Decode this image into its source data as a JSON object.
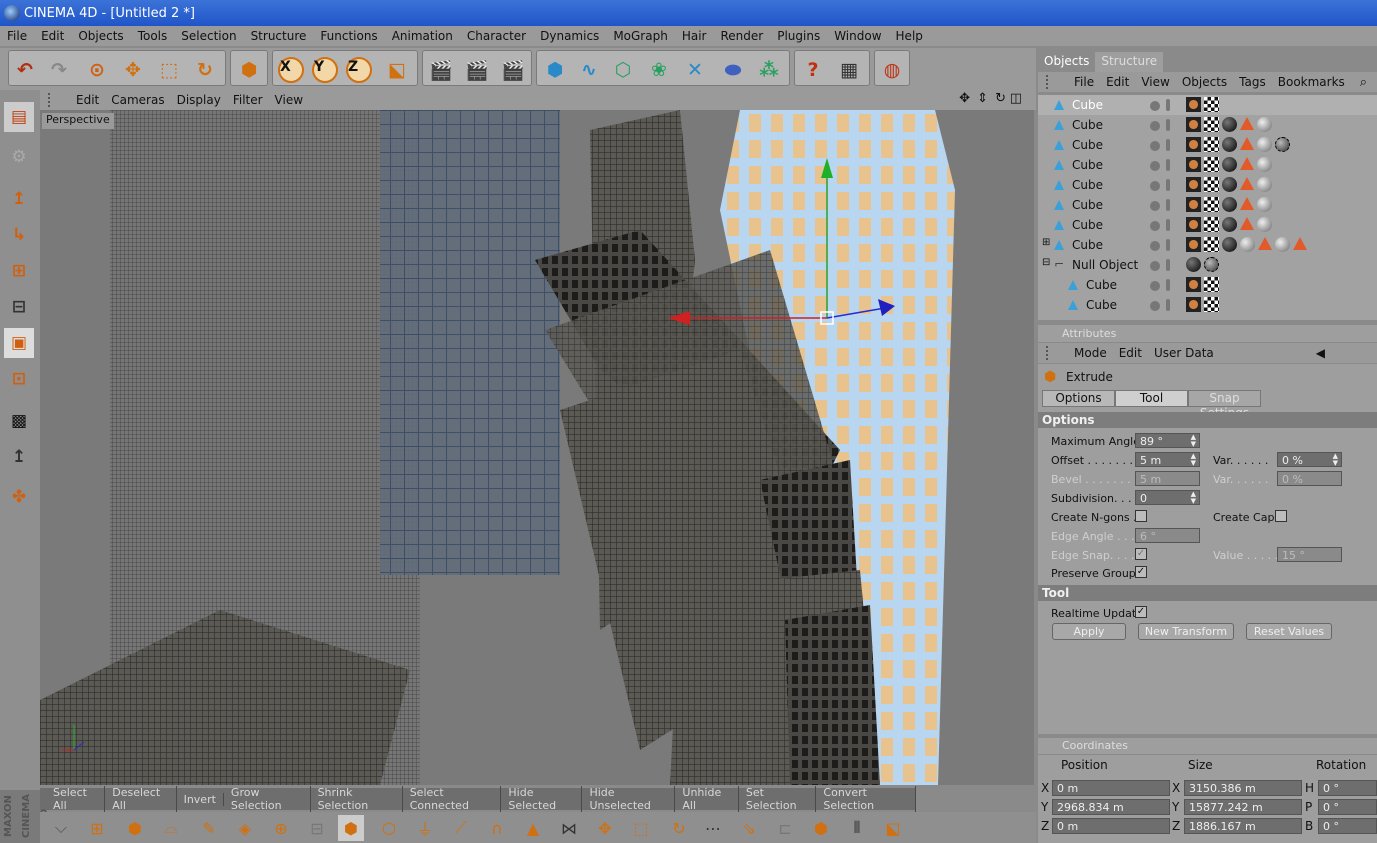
{
  "window": {
    "title": "CINEMA 4D - [Untitled 2 *]"
  },
  "menubar": [
    "File",
    "Edit",
    "Objects",
    "Tools",
    "Selection",
    "Structure",
    "Functions",
    "Animation",
    "Character",
    "Dynamics",
    "MoGraph",
    "Hair",
    "Render",
    "Plugins",
    "Window",
    "Help"
  ],
  "toolbar": {
    "axis_labels": [
      "X",
      "Y",
      "Z"
    ]
  },
  "viewport": {
    "menu": [
      "Edit",
      "Cameras",
      "Display",
      "Filter",
      "View"
    ],
    "label": "Perspective",
    "selection_bar": [
      "Select All",
      "Deselect All",
      "Invert",
      "Grow Selection",
      "Shrink Selection",
      "Select Connected",
      "Hide Selected",
      "Hide Unselected",
      "Unhide All",
      "Set Selection",
      "Convert Selection"
    ]
  },
  "branding": {
    "vertical_logo": "MAXON CINEMA 4D"
  },
  "objects_panel": {
    "tabs": [
      "Objects",
      "Structure"
    ],
    "menu": [
      "File",
      "Edit",
      "View",
      "Objects",
      "Tags",
      "Bookmarks"
    ],
    "rows": [
      {
        "name": "Cube",
        "tags": [
          "phong",
          "check"
        ]
      },
      {
        "name": "Cube",
        "tags": [
          "phong",
          "check",
          "black",
          "tri",
          "sphere"
        ]
      },
      {
        "name": "Cube",
        "tags": [
          "phong",
          "check",
          "black",
          "tri",
          "sphere",
          "grey"
        ]
      },
      {
        "name": "Cube",
        "tags": [
          "phong",
          "check",
          "black",
          "tri",
          "sphere"
        ]
      },
      {
        "name": "Cube",
        "tags": [
          "phong",
          "check",
          "black",
          "tri",
          "sphere"
        ]
      },
      {
        "name": "Cube",
        "tags": [
          "phong",
          "check",
          "black",
          "tri",
          "sphere"
        ]
      },
      {
        "name": "Cube",
        "tags": [
          "phong",
          "check",
          "black",
          "tri",
          "sphere"
        ]
      },
      {
        "name": "Cube",
        "tags": [
          "phong",
          "check",
          "black",
          "sphere",
          "tri",
          "sphere",
          "tri"
        ]
      },
      {
        "name": "Null Object",
        "tags": [
          "black",
          "grey"
        ]
      },
      {
        "name": "Cube",
        "tags": [
          "phong",
          "check"
        ]
      },
      {
        "name": "Cube",
        "tags": [
          "phong",
          "check"
        ]
      }
    ]
  },
  "attributes": {
    "header": "Attributes",
    "menu": [
      "Mode",
      "Edit",
      "User Data"
    ],
    "tool_name": "Extrude",
    "tabs": [
      "Options",
      "Tool",
      "Snap Settings"
    ],
    "options_title": "Options",
    "max_angle_label": "Maximum Angle",
    "max_angle": "89 °",
    "offset_label": "Offset . . . . . . . .",
    "offset": "5 m",
    "var1_label": "Var. . . . . .",
    "var1": "0 %",
    "bevel_label": "Bevel . . . . . . . .",
    "bevel": "5 m",
    "var2_label": "Var. . . . . .",
    "var2": "0 %",
    "subdivision_label": "Subdivision. . . .",
    "subdivision": "0",
    "create_ngons": "Create N-gons .",
    "create_caps": "Create Caps",
    "edge_angle_label": "Edge Angle . . .",
    "edge_angle": "6 °",
    "edge_snap_label": "Edge Snap. . . .",
    "value_label": "Value . . . . .",
    "value": "15 °",
    "preserve_groups": "Preserve Groups",
    "tool_title": "Tool",
    "realtime_update": "Realtime Update",
    "apply": "Apply",
    "new_transform": "New Transform",
    "reset_values": "Reset Values"
  },
  "coordinates": {
    "header": "Coordinates",
    "col_position": "Position",
    "col_size": "Size",
    "col_rotation": "Rotation",
    "x_label": "X",
    "y_label": "Y",
    "z_label": "Z",
    "h_label": "H",
    "p_label": "P",
    "b_label": "B",
    "pos_x": "0 m",
    "pos_y": "2968.834 m",
    "pos_z": "0 m",
    "size_x": "3150.386 m",
    "size_y": "15877.242 m",
    "size_z": "1886.167 m",
    "rot_h": "0 °",
    "rot_p": "0 °",
    "rot_b": "0 °"
  }
}
